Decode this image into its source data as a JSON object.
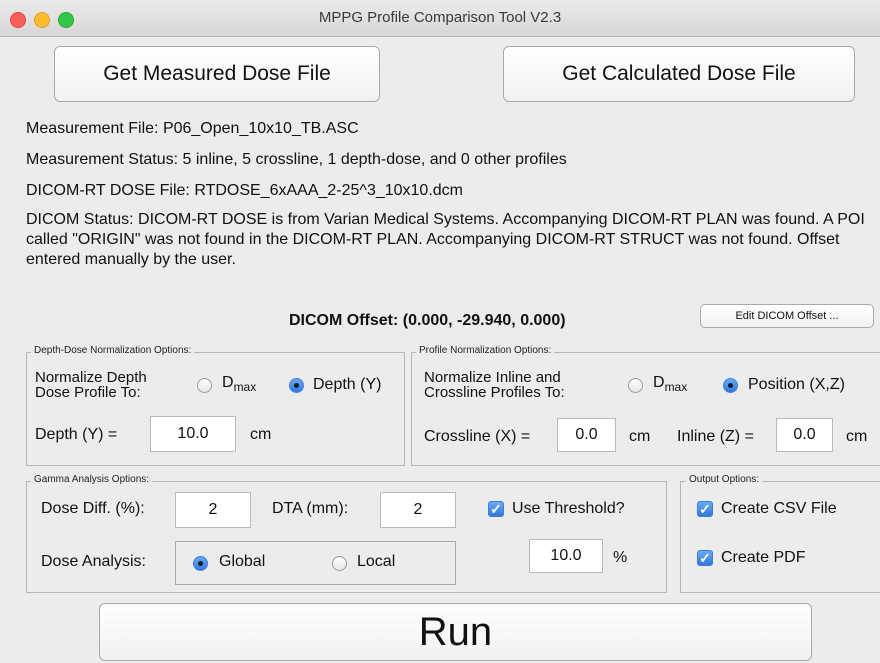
{
  "window": {
    "title": "MPPG Profile Comparison Tool V2.3"
  },
  "buttons": {
    "get_measured": "Get Measured Dose File",
    "get_calculated": "Get Calculated Dose File",
    "edit_offset": "Edit DICOM Offset ...",
    "run": "Run"
  },
  "info": {
    "measurement_file": "Measurement File: P06_Open_10x10_TB.ASC",
    "measurement_status": "Measurement Status: 5 inline, 5 crossline, 1 depth-dose, and 0 other profiles",
    "dicom_file": "DICOM-RT DOSE File: RTDOSE_6xAAA_2-25^3_10x10.dcm",
    "dicom_status": "DICOM Status: DICOM-RT DOSE is from Varian Medical Systems. Accompanying DICOM-RT PLAN was found. A POI called \"ORIGIN\" was not found in the DICOM-RT PLAN. Accompanying DICOM-RT STRUCT was not found. Offset entered manually by the user.",
    "dicom_offset": "DICOM Offset: (0.000, -29.940, 0.000)"
  },
  "depth_norm": {
    "group_label": "Depth-Dose Normalization Options:",
    "prompt_line1": "Normalize Depth",
    "prompt_line2": "Dose Profile To:",
    "opt_dmax": "D",
    "opt_dmax_sub": "max",
    "opt_depth": "Depth (Y)",
    "selected": "Depth (Y)",
    "depth_label": "Depth (Y) =",
    "depth_value": "10.0",
    "depth_unit": "cm"
  },
  "profile_norm": {
    "group_label": "Profile Normalization Options:",
    "prompt_line1": "Normalize Inline and",
    "prompt_line2": "Crossline Profiles To:",
    "opt_dmax": "D",
    "opt_dmax_sub": "max",
    "opt_position": "Position (X,Z)",
    "selected": "Position (X,Z)",
    "crossline_label": "Crossline (X) =",
    "crossline_value": "0.0",
    "crossline_unit": "cm",
    "inline_label": "Inline (Z) =",
    "inline_value": "0.0",
    "inline_unit": "cm"
  },
  "gamma": {
    "group_label": "Gamma Analysis Options:",
    "dose_diff_label": "Dose Diff. (%):",
    "dose_diff_value": "2",
    "dta_label": "DTA (mm):",
    "dta_value": "2",
    "use_threshold_label": "Use Threshold?",
    "use_threshold_checked": true,
    "threshold_value": "10.0",
    "threshold_unit": "%",
    "dose_analysis_label": "Dose Analysis:",
    "opt_global": "Global",
    "opt_local": "Local",
    "selected": "Global"
  },
  "output": {
    "group_label": "Output Options:",
    "csv_label": "Create CSV File",
    "csv_checked": true,
    "pdf_label": "Create PDF",
    "pdf_checked": true
  },
  "colors": {
    "accent": "#2f78e0",
    "window_bg": "#ececec"
  }
}
